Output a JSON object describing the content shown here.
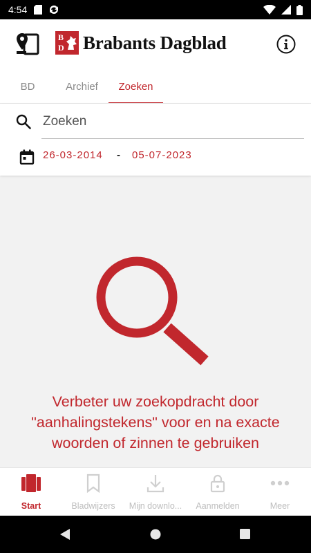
{
  "status_bar": {
    "time": "4:54",
    "icons": [
      "sd-card-icon",
      "sync-icon",
      "wifi-icon",
      "signal-icon",
      "battery-icon"
    ]
  },
  "header": {
    "brand": "Brabants Dagblad",
    "logo_letters": [
      "B",
      "D"
    ],
    "left_icon": "device-location-icon",
    "right_icon": "info-icon"
  },
  "tabs": [
    {
      "label": "BD",
      "active": false
    },
    {
      "label": "Archief",
      "active": false
    },
    {
      "label": "Zoeken",
      "active": true
    }
  ],
  "search": {
    "placeholder": "Zoeken",
    "value": "",
    "date_from": "26-03-2014",
    "date_separator": "-",
    "date_to": "05-07-2023"
  },
  "empty_state": {
    "icon": "magnifier-icon",
    "message": "Verbeter uw zoekopdracht door \"aanhalingstekens\" voor en na exacte woorden of zinnen te gebruiken"
  },
  "bottom_nav": [
    {
      "label": "Start",
      "icon": "start-icon",
      "active": true
    },
    {
      "label": "Bladwijzers",
      "icon": "bookmark-icon",
      "active": false
    },
    {
      "label": "Mijn downlo...",
      "icon": "download-icon",
      "active": false
    },
    {
      "label": "Aanmelden",
      "icon": "lock-icon",
      "active": false
    },
    {
      "label": "Meer",
      "icon": "more-icon",
      "active": false
    }
  ],
  "colors": {
    "accent": "#c1272d",
    "inactive": "#bdbdbd",
    "text": "#111111",
    "background": "#f2f2f2"
  }
}
